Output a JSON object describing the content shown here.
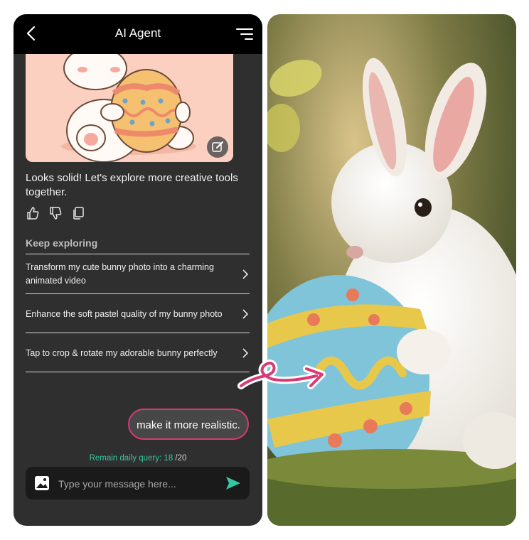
{
  "header": {
    "title": "AI Agent"
  },
  "agent_message": "Looks solid! Let's explore more creative tools together.",
  "keep_exploring": {
    "heading": "Keep exploring",
    "items": [
      {
        "label": "Transform my cute bunny photo into a charming animated video"
      },
      {
        "label": "Enhance the soft pastel quality of my bunny photo"
      },
      {
        "label": "Tap to crop & rotate my adorable bunny perfectly"
      }
    ]
  },
  "user_message": "make it more realistic.",
  "query": {
    "label": "Remain daily query:",
    "used": "18",
    "total": "/20"
  },
  "composer": {
    "placeholder": "Type your message here..."
  },
  "colors": {
    "accent_pink": "#d83a77",
    "accent_green": "#32c9a0",
    "panel": "#2f2f2f"
  },
  "icons": [
    "back-chevron-icon",
    "menu-icon",
    "edit-image-icon",
    "thumbs-up-icon",
    "thumbs-down-icon",
    "copy-icon",
    "chevron-right-icon",
    "image-icon",
    "send-icon",
    "curly-arrow-icon"
  ]
}
